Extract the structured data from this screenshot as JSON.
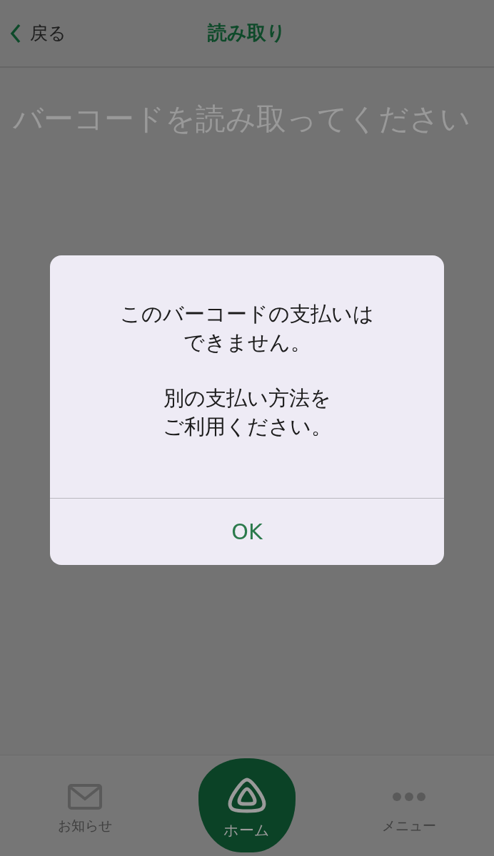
{
  "header": {
    "back_label": "戻る",
    "title": "読み取り"
  },
  "prompt": "バーコードを読み取ってください",
  "dialog": {
    "paragraphs": [
      [
        "このバーコードの支払いは",
        "できません。"
      ],
      [
        "別の支払い方法を",
        "ご利用ください。"
      ]
    ],
    "buttons": [
      {
        "label": "OK"
      }
    ]
  },
  "tab_bar": [
    {
      "label": "お知らせ",
      "kind": "mail",
      "selected": false
    },
    {
      "label": "ホーム",
      "kind": "home",
      "selected": true
    },
    {
      "label": "メニュー",
      "kind": "more",
      "selected": false
    }
  ]
}
